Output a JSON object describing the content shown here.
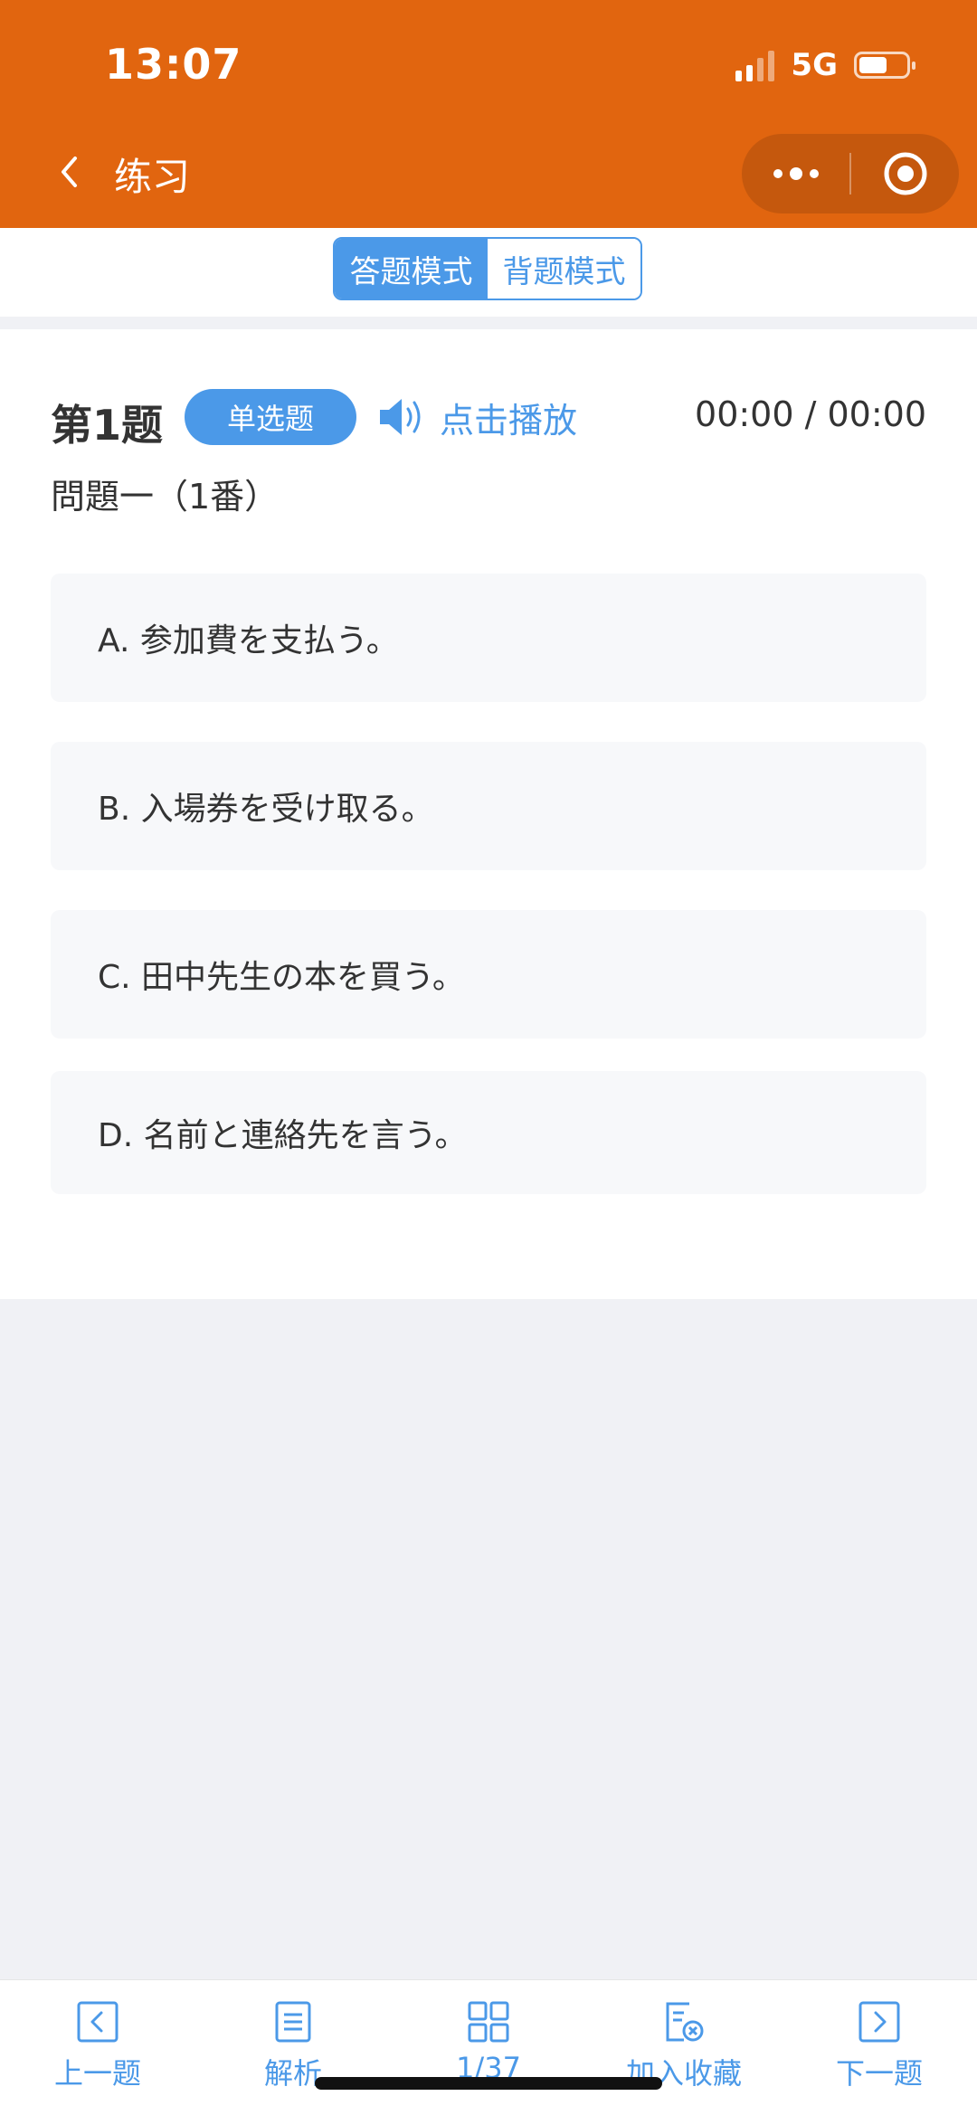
{
  "status_bar": {
    "time": "13:07",
    "network": "5G"
  },
  "nav": {
    "title": "练习",
    "back_icon": "chevron-left-icon",
    "more_icon": "more-dots-icon",
    "target_icon": "target-icon"
  },
  "mode_switch": {
    "options": [
      {
        "label": "答题模式",
        "active": true
      },
      {
        "label": "背题模式",
        "active": false
      }
    ]
  },
  "question": {
    "number_label": "第1题",
    "type_label": "单选题",
    "play_label": "点击播放",
    "timer": "00:00 / 00:00",
    "text": "問題一（1番）",
    "options": [
      {
        "text": "A. 参加費を支払う。"
      },
      {
        "text": "B. 入場券を受け取る。"
      },
      {
        "text": "C. 田中先生の本を買う。"
      },
      {
        "text": "D. 名前と連絡先を言う。"
      }
    ]
  },
  "bottom_tabs": [
    {
      "label": "上一题",
      "icon": "prev-icon"
    },
    {
      "label": "解析",
      "icon": "analysis-icon"
    },
    {
      "label": "1/37",
      "icon": "grid-icon"
    },
    {
      "label": "加入收藏",
      "icon": "favorite-add-icon"
    },
    {
      "label": "下一题",
      "icon": "next-icon"
    }
  ],
  "colors": {
    "header": "#e1650f",
    "accent": "#4b99e8",
    "page_bg": "#f0f1f5",
    "option_bg": "#f7f8fa"
  }
}
